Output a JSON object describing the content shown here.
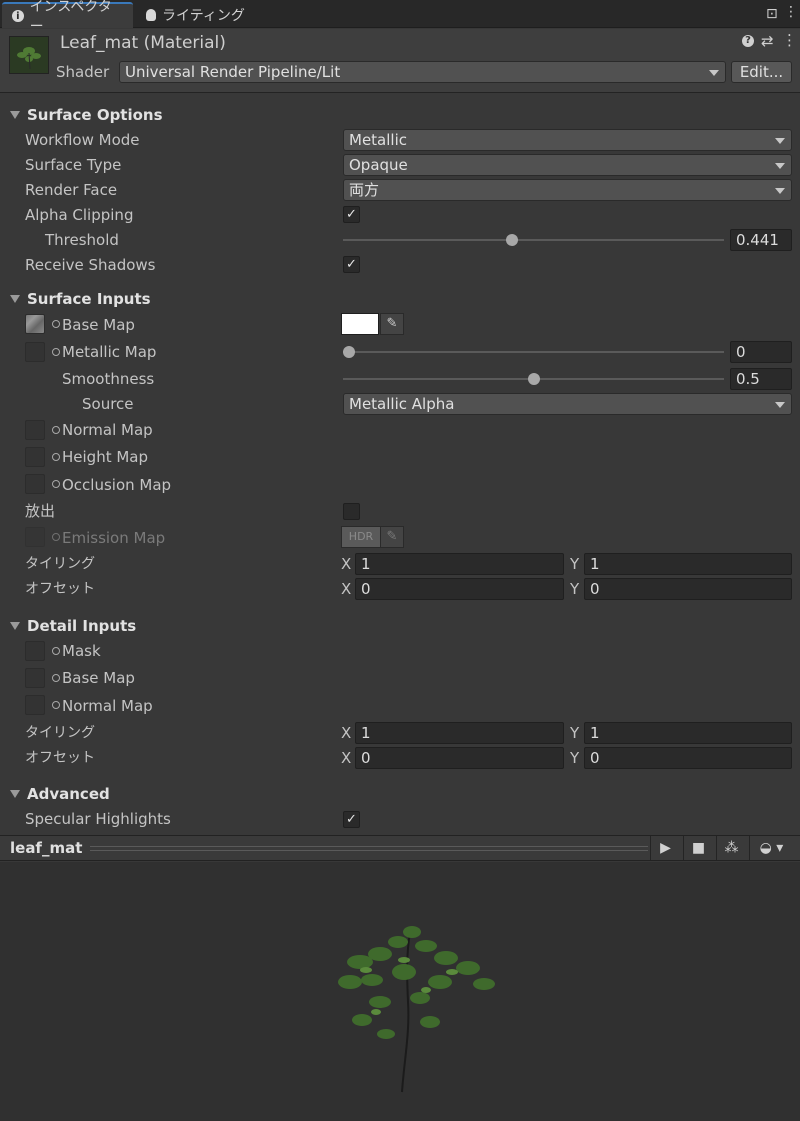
{
  "tabs": [
    {
      "label": "インスペクター",
      "icon": "info-icon"
    },
    {
      "label": "ライティング",
      "icon": "bulb-icon"
    }
  ],
  "header": {
    "title": "Leaf_mat (Material)",
    "shader_label": "Shader",
    "shader_value": "Universal Render Pipeline/Lit",
    "edit_label": "Edit..."
  },
  "surface_options": {
    "title": "Surface Options",
    "workflow_label": "Workflow Mode",
    "workflow_value": "Metallic",
    "surface_type_label": "Surface Type",
    "surface_type_value": "Opaque",
    "render_face_label": "Render Face",
    "render_face_value": "両方",
    "alpha_clipping_label": "Alpha Clipping",
    "alpha_clipping_checked": true,
    "threshold_label": "Threshold",
    "threshold_value": "0.441",
    "threshold_fraction": 0.441,
    "receive_shadows_label": "Receive Shadows",
    "receive_shadows_checked": true
  },
  "surface_inputs": {
    "title": "Surface Inputs",
    "base_map_label": "Base Map",
    "metallic_map_label": "Metallic Map",
    "metallic_value": "0",
    "metallic_fraction": 0,
    "smoothness_label": "Smoothness",
    "smoothness_value": "0.5",
    "smoothness_fraction": 0.5,
    "source_label": "Source",
    "source_value": "Metallic Alpha",
    "normal_map_label": "Normal Map",
    "height_map_label": "Height Map",
    "occlusion_map_label": "Occlusion Map",
    "emission_label": "放出",
    "emission_checked": false,
    "emission_map_label": "Emission Map",
    "hdr_label": "HDR",
    "tiling_label": "タイリング",
    "tiling_x": "1",
    "tiling_y": "1",
    "offset_label": "オフセット",
    "offset_x": "0",
    "offset_y": "0"
  },
  "detail_inputs": {
    "title": "Detail Inputs",
    "mask_label": "Mask",
    "base_map_label": "Base Map",
    "normal_map_label": "Normal Map",
    "tiling_label": "タイリング",
    "tiling_x": "1",
    "tiling_y": "1",
    "offset_label": "オフセット",
    "offset_x": "0",
    "offset_y": "0"
  },
  "advanced": {
    "title": "Advanced",
    "specular_label": "Specular Highlights",
    "specular_checked": true
  },
  "axis": {
    "x": "X",
    "y": "Y"
  },
  "preview": {
    "title": "leaf_mat"
  },
  "colors": {
    "accent": "#3a79bb",
    "background": "#383838",
    "base_color": "#ffffff"
  }
}
